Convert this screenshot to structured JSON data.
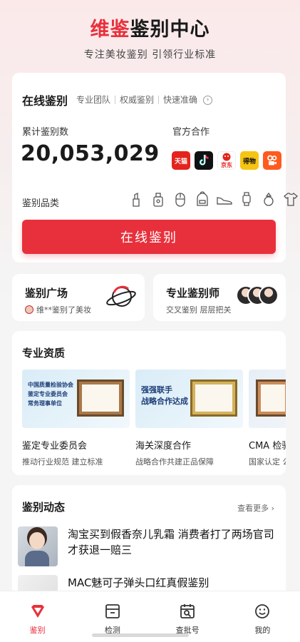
{
  "header": {
    "brand": "维鉴",
    "title_rest": "鉴别中心",
    "subtitle": "专注美妆鉴别 引领行业标准"
  },
  "main_card": {
    "title": "在线鉴别",
    "tags": [
      "专业团队",
      "权威鉴别",
      "快速准确"
    ],
    "count_label": "累计鉴别数",
    "count_value": "20,053,029",
    "partner_label": "官方合作",
    "partners": [
      {
        "name": "天猫",
        "color": "#e4231c"
      },
      {
        "name": "抖音",
        "color": "#111111"
      },
      {
        "name": "京东",
        "color": "#e4231c"
      },
      {
        "name": "得物",
        "color": "#f6c413"
      },
      {
        "name": "快手",
        "color": "#ff5a1f"
      }
    ],
    "category_label": "鉴别品类",
    "category_icons": [
      "lipstick-icon",
      "perfume-icon",
      "mouse-icon",
      "backpack-icon",
      "sneaker-icon",
      "watch-icon",
      "ring-icon",
      "tshirt-icon"
    ],
    "cta_label": "在线鉴别"
  },
  "square_card": {
    "title": "鉴别广场",
    "sub": "维**鉴别了美妆"
  },
  "expert_card": {
    "title": "专业鉴别师",
    "sub": "交叉鉴别 层层把关"
  },
  "qualification": {
    "title": "专业资质",
    "items": [
      {
        "img_lines": [
          "中国质量检验协会",
          "鉴定专业委员会",
          "常务理事单位"
        ],
        "name": "鉴定专业委员会",
        "desc": "推动行业规范 建立标准"
      },
      {
        "img_lines": [
          "强强联手",
          "战略合作达成"
        ],
        "name": "海关深度合作",
        "desc": "战略合作共建正品保障"
      },
      {
        "img_lines": [],
        "name": "CMA 检验",
        "desc": "国家认定 公"
      }
    ]
  },
  "news": {
    "title": "鉴别动态",
    "more": "查看更多",
    "items": [
      {
        "text": "淘宝买到假香奈儿乳霜 消费者打了两场官司才获退一赔三"
      },
      {
        "text": "MAC魅可子弹头口红真假鉴别"
      }
    ]
  },
  "nav": {
    "items": [
      {
        "label": "鉴别",
        "icon": "gem-icon",
        "active": true
      },
      {
        "label": "检测",
        "icon": "box-icon",
        "active": false
      },
      {
        "label": "查批号",
        "icon": "calendar-search-icon",
        "active": false
      },
      {
        "label": "我的",
        "icon": "smile-icon",
        "active": false
      }
    ]
  },
  "colors": {
    "accent": "#e8303c"
  }
}
